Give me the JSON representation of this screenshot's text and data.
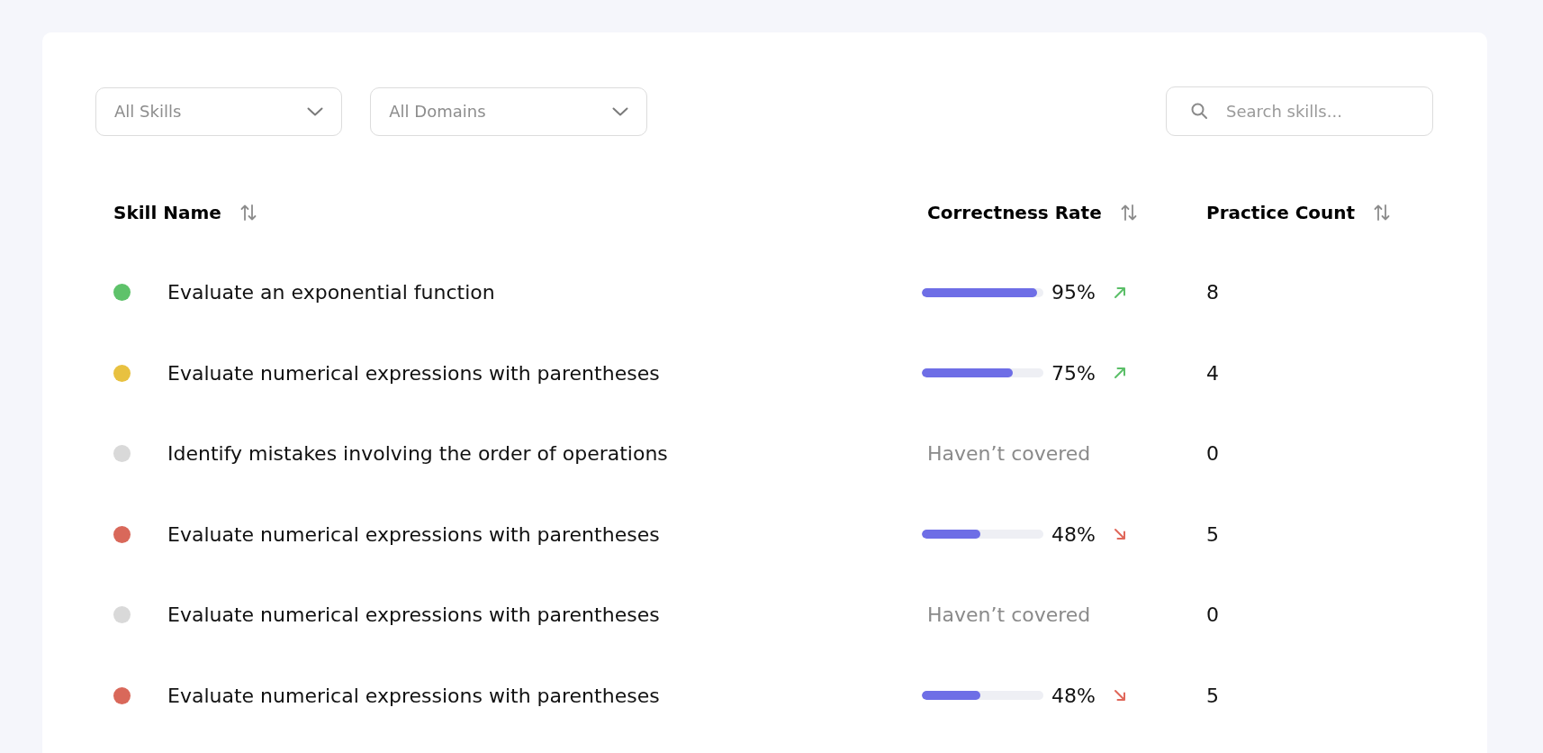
{
  "filters": [
    {
      "value": "All Skills"
    },
    {
      "value": "All Domains"
    }
  ],
  "search": {
    "placeholder": "Search skills..."
  },
  "table": {
    "columns": [
      {
        "label": "Skill Name"
      },
      {
        "label": "Correctness Rate"
      },
      {
        "label": "Practice Count"
      }
    ],
    "rows": [
      {
        "color": "#5ec26a",
        "skill": "Evaluate an exponential function",
        "rate": {
          "kind": "bar",
          "level": 0.95,
          "reading": "95%",
          "improving": true
        },
        "count": "8"
      },
      {
        "color": "#e8c140",
        "skill": "Evaluate numerical expressions with parentheses",
        "rate": {
          "kind": "bar",
          "level": 0.75,
          "reading": "75%",
          "improving": true
        },
        "count": "4"
      },
      {
        "color": "#d9d9d9",
        "skill": "Identify mistakes involving the order of operations",
        "rate": {
          "kind": "text",
          "text": "Haven’t covered"
        },
        "count": "0"
      },
      {
        "color": "#d9685a",
        "skill": "Evaluate numerical expressions with parentheses",
        "rate": {
          "kind": "bar",
          "level": 0.48,
          "reading": "48%",
          "improving": false
        },
        "count": "5"
      },
      {
        "color": "#d9d9d9",
        "skill": "Evaluate numerical expressions with parentheses",
        "rate": {
          "kind": "text",
          "text": "Haven’t covered"
        },
        "count": "0"
      },
      {
        "color": "#d9685a",
        "skill": "Evaluate numerical expressions with parentheses",
        "rate": {
          "kind": "bar",
          "level": 0.48,
          "reading": "48%",
          "improving": false
        },
        "count": "5"
      }
    ]
  }
}
